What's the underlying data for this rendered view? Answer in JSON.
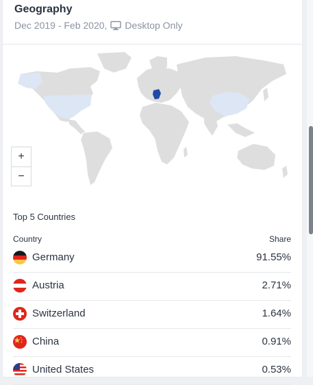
{
  "header": {
    "title": "Geography",
    "date_range": "Dec 2019 - Feb 2020,",
    "device_icon": "desktop-icon",
    "device": "Desktop Only"
  },
  "map": {
    "highlight_color": "#1f4aa8",
    "light_color": "#dde6f4",
    "land_color": "#dedede",
    "zoom_in_label": "+",
    "zoom_out_label": "−"
  },
  "table": {
    "section_title": "Top 5 Countries",
    "col_country": "Country",
    "col_share": "Share",
    "rows": [
      {
        "country": "Germany",
        "share": "91.55%",
        "flag_icon": "germany-flag-icon"
      },
      {
        "country": "Austria",
        "share": "2.71%",
        "flag_icon": "austria-flag-icon"
      },
      {
        "country": "Switzerland",
        "share": "1.64%",
        "flag_icon": "switzerland-flag-icon"
      },
      {
        "country": "China",
        "share": "0.91%",
        "flag_icon": "china-flag-icon"
      },
      {
        "country": "United States",
        "share": "0.53%",
        "flag_icon": "united-states-flag-icon"
      }
    ]
  }
}
